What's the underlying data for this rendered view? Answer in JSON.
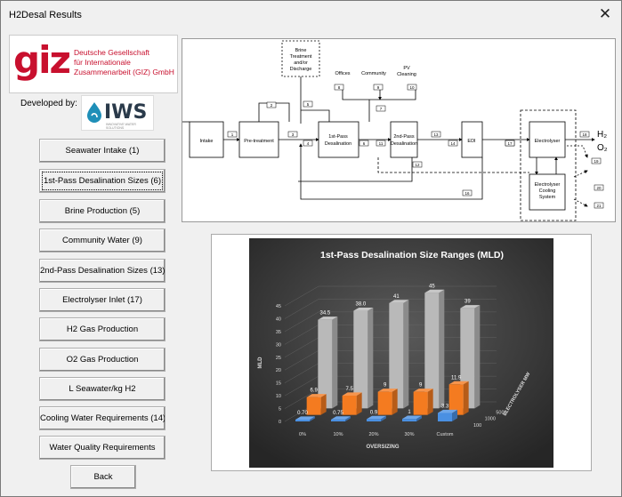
{
  "window": {
    "title": "H2Desal Results",
    "close_label": "✕"
  },
  "logos": {
    "giz_mark": "giz",
    "giz_lines": [
      "Deutsche Gesellschaft",
      "für Internationale",
      "Zusammenarbeit (GIZ) GmbH"
    ],
    "developed_by": "Developed by:",
    "iws_mark": "IWS",
    "iws_sub": "INNOVATIVE WATER SOLUTIONS",
    "giz_color": "#c8102e"
  },
  "buttons": [
    {
      "label": "Seawater Intake (1)",
      "active": false
    },
    {
      "label": "1st-Pass Desalination Sizes (6)",
      "active": true
    },
    {
      "label": "Brine Production (5)",
      "active": false
    },
    {
      "label": "Community Water (9)",
      "active": false
    },
    {
      "label": "2nd-Pass Desalination Sizes (13)",
      "active": false
    },
    {
      "label": "Electrolyser Inlet (17)",
      "active": false
    },
    {
      "label": "H2 Gas Production",
      "active": false
    },
    {
      "label": "O2 Gas Production",
      "active": false
    },
    {
      "label": "L Seawater/kg H2",
      "active": false
    },
    {
      "label": "Cooling Water Requirements (14)",
      "active": false
    },
    {
      "label": "Water Quality Requirements",
      "active": false
    }
  ],
  "back_label": "Back",
  "diagram": {
    "boxes": {
      "intake": "Intake",
      "pretreatment": "Pre-treatment",
      "brine": [
        "Brine",
        "Treatment",
        "and/or",
        "Discharge"
      ],
      "pass1": [
        "1st-Pass",
        "Desalination"
      ],
      "pass2": [
        "2nd-Pass",
        "Desalination"
      ],
      "edi": "EDI",
      "electrolyser": "Electrolyser",
      "cooling": [
        "Electrolyser",
        "Cooling",
        "System"
      ]
    },
    "uses": {
      "offices": "Offices",
      "community": "Community",
      "pv": [
        "PV",
        "Cleaning"
      ]
    },
    "outputs": {
      "h2": "H₂",
      "o2": "O₂"
    },
    "streams": [
      "1",
      "2",
      "3",
      "4",
      "5",
      "6",
      "7",
      "8",
      "9",
      "10",
      "11",
      "12",
      "13",
      "14",
      "15",
      "16",
      "17",
      "18",
      "19",
      "20",
      "21"
    ]
  },
  "chart_data": {
    "type": "bar",
    "title": "1st-Pass Desalination Size Ranges (MLD)",
    "xlabel": "OVERSIZING",
    "ylabel": "MLD",
    "zlabel": "ELECTROLYSER MW",
    "categories": [
      "0%",
      "10%",
      "20%",
      "30%",
      "Custom"
    ],
    "depth_categories": [
      "100",
      "1000",
      "5000"
    ],
    "ylim": [
      0,
      45
    ],
    "yticks": [
      0,
      5,
      10,
      15,
      20,
      25,
      30,
      35,
      40,
      45
    ],
    "series": [
      {
        "name": "100",
        "values": [
          0.7,
          0.75,
          0.9,
          1,
          3.3
        ],
        "color": "#4a90e2"
      },
      {
        "name": "1000",
        "values": [
          6.9,
          7.5,
          9,
          9,
          11.9
        ],
        "color": "#f47b20"
      },
      {
        "name": "5000",
        "values": [
          34.5,
          38.0,
          41,
          45,
          39
        ],
        "color": "#b9b9b9"
      }
    ],
    "labels": {
      "100": [
        "0.70",
        "0.75",
        "0.9",
        "1",
        "3.3"
      ],
      "1000": [
        "6.9",
        "7.5",
        "9",
        "9",
        "11.9"
      ],
      "5000": [
        "34.5",
        "38.0",
        "41",
        "45",
        "39"
      ]
    }
  }
}
